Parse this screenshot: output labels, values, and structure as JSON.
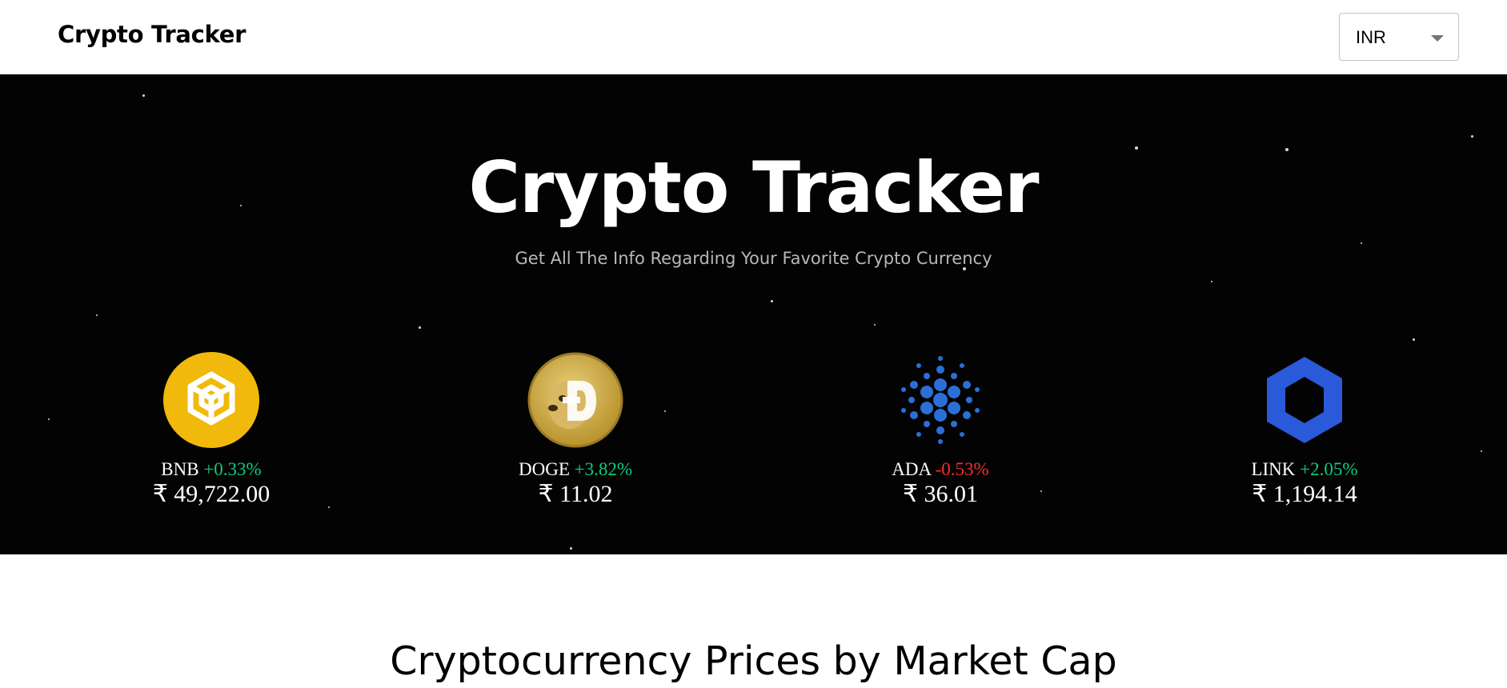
{
  "navbar": {
    "brand": "Crypto Tracker",
    "currency_select": {
      "value": "INR"
    }
  },
  "banner": {
    "title": "Crypto Tracker",
    "subtitle": "Get All The Info Regarding Your Favorite Crypto Currency",
    "coins": [
      {
        "symbol": "BNB",
        "change": "+0.33%",
        "price": "₹ 49,722.00",
        "trend": "up",
        "icon": "bnb-logo-icon"
      },
      {
        "symbol": "DOGE",
        "change": "+3.82%",
        "price": "₹ 11.02",
        "trend": "up",
        "icon": "doge-logo-icon"
      },
      {
        "symbol": "ADA",
        "change": "-0.53%",
        "price": "₹ 36.01",
        "trend": "down",
        "icon": "cardano-logo-icon"
      },
      {
        "symbol": "LINK",
        "change": "+2.05%",
        "price": "₹ 1,194.14",
        "trend": "up",
        "icon": "chainlink-logo-icon"
      }
    ]
  },
  "main": {
    "section_title": "Cryptocurrency Prices by Market Cap"
  },
  "colors": {
    "positive": "#0ecb81",
    "negative": "#ff2a2a",
    "bnb_yellow": "#f0b90b",
    "cardano_blue": "#2a6fd6",
    "chainlink_blue": "#2a5ada",
    "doge_gold": "#c8a43c"
  }
}
